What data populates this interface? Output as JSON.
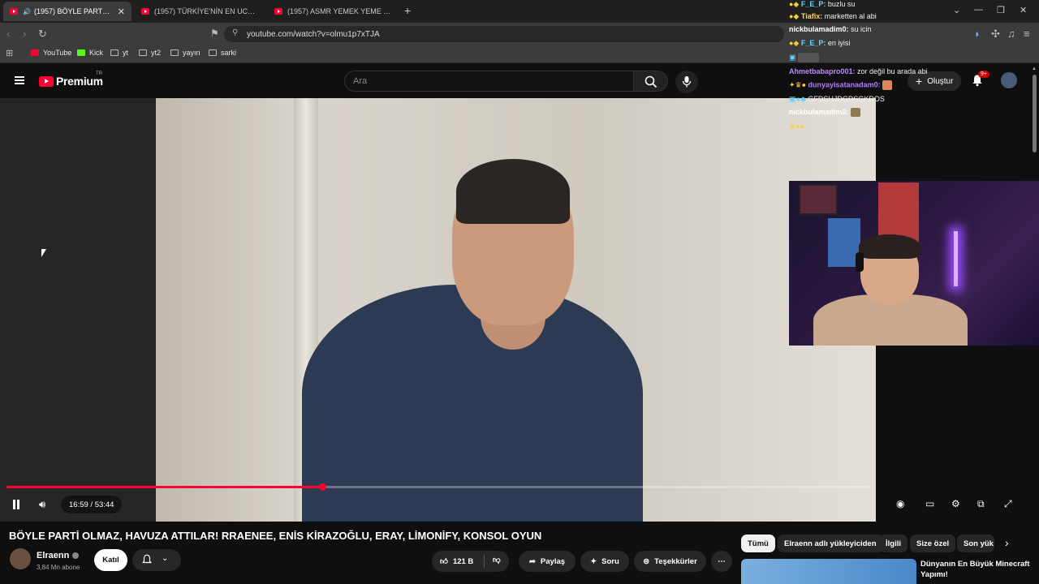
{
  "browser": {
    "tabs": [
      {
        "label": "(1957) BÖYLE PARTİ OLMAZ, "
      },
      {
        "label": "(1957) TÜRKİYE'NİN EN UCUZ TAVUK"
      },
      {
        "label": "(1957) ASMR YEMEK YEME MUKBAN"
      }
    ],
    "new_tab": "+",
    "url": "youtube.com/watch?v=olmu1p7xTJA",
    "bookmarks": [
      {
        "label": "YouTube",
        "icon": "youtube-icon"
      },
      {
        "label": "Kick",
        "icon": "kick-icon"
      },
      {
        "label": "yt",
        "icon": "folder-icon"
      },
      {
        "label": "yt2",
        "icon": "folder-icon"
      },
      {
        "label": "yayın",
        "icon": "folder-icon"
      },
      {
        "label": "sarki",
        "icon": "folder-icon"
      }
    ]
  },
  "youtube": {
    "logo_text": "Premium",
    "region": "TR",
    "search_placeholder": "Ara",
    "create_label": "Oluştur",
    "notif_badge": "9+"
  },
  "player": {
    "time": "16:59 / 53:44",
    "progress": 0.3655
  },
  "chat": [
    {
      "user": "F_E_P:",
      "msg": "buzlu su",
      "color": "#5fd6ff"
    },
    {
      "user": "Tiafix:",
      "msg": "marketten al abi",
      "color": "#ffd84a"
    },
    {
      "user": "nickbulamadim0:",
      "msg": "su icin",
      "color": "#ffffff"
    },
    {
      "user": "F_E_P:",
      "msg": "en iyisi",
      "color": "#5fd6ff"
    },
    {
      "user": "Ahmetbabapro001:",
      "msg": "zor değil bu arada abi",
      "color": "#c08aff"
    },
    {
      "user": "dunyayisatanadam0:",
      "msg": "",
      "color": "#b27cff"
    },
    {
      "user": "",
      "msg": "GFDSHJDGDSGKDOS",
      "color": "#ffffff"
    },
    {
      "user": "nickbulamadim0:",
      "msg": "",
      "color": "#ffffff"
    }
  ],
  "video": {
    "title": "BÖYLE PARTİ OLMAZ, HAVUZA ATTILAR! RRAENEE, ENİS KİRAZOĞLU, ERAY, LİMONİFY, KONSOL OYUN",
    "channel": "Elraenn",
    "subs": "3,84 Mn abone",
    "join": "Katıl",
    "likes": "121 B",
    "share": "Paylaş",
    "ask": "Soru",
    "thanks": "Teşekkürler"
  },
  "chips": [
    "Tümü",
    "Elraenn adlı yükleyiciden",
    "İlgili",
    "Size özel",
    "Son yük"
  ],
  "recommendation": {
    "title": "Dünyanın En Büyük Minecraft Yapımı!"
  },
  "colors": {
    "accent": "#ff0033",
    "bg": "#0f0f0f"
  }
}
